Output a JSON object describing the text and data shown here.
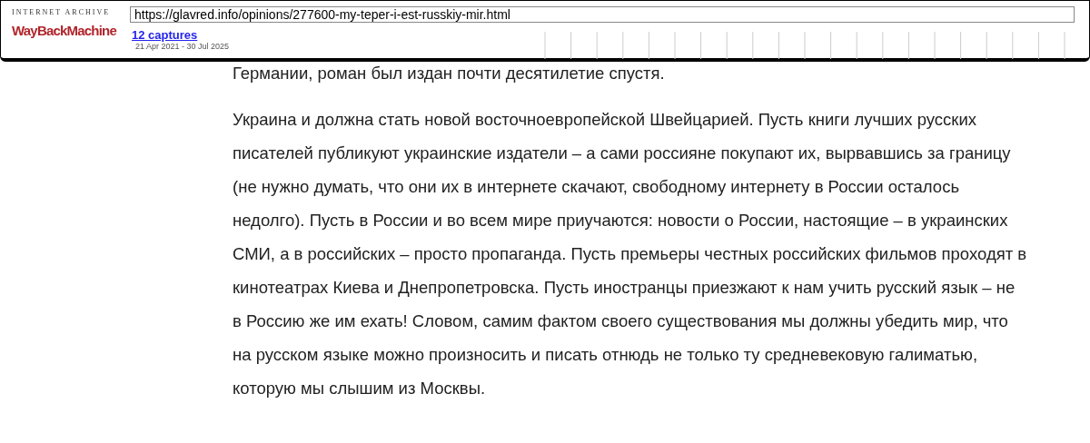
{
  "toolbar": {
    "logo_top": "INTERNET ARCHIVE",
    "logo_main": "WayBackMachine",
    "url": "https://glavred.info/opinions/277600-my-teper-i-est-russkiy-mir.html",
    "captures_link": "12 captures",
    "date_range": "21 Apr 2021 - 30 Jul 2025"
  },
  "article": {
    "paragraphs": [
      "Германии, роман был издан почти десятилетие спустя.",
      "Украина и должна стать новой восточноевропейской Швейцарией. Пусть книги лучших русских писателей публикуют украинские издатели – а сами россияне покупают их, вырвавшись за границу (не нужно думать, что они их в интернете скачают, свободному интернету в России осталось недолго). Пусть в России и во всем мире приучаются: новости о России, настоящие – в украинских СМИ, а в российских – просто пропаганда. Пусть премьеры честных российских фильмов проходят в кинотеатрах Киева и Днепропетровска. Пусть иностранцы приезжают к нам учить русский язык – не в Россию же им ехать! Словом, самим фактом своего существования мы должны убедить мир, что на русском языке можно произносить и писать отнюдь не только ту средневековую галиматью, которую мы слышим из Москвы."
    ]
  }
}
